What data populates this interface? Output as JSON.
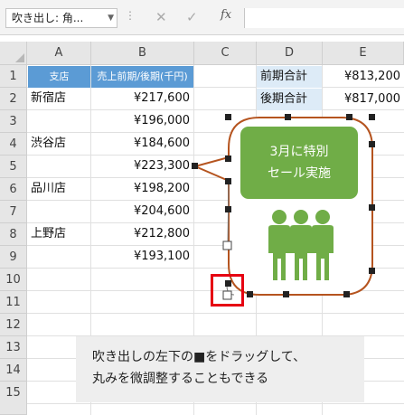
{
  "formula_bar": {
    "name_box": "吹き出し: 角...",
    "cancel_icon": "✕",
    "enter_icon": "✓",
    "fx_label": "fx",
    "formula": ""
  },
  "columns": [
    "A",
    "B",
    "C",
    "D",
    "E"
  ],
  "rows": [
    "1",
    "2",
    "3",
    "4",
    "5",
    "6",
    "7",
    "8",
    "9",
    "10",
    "11",
    "12",
    "13",
    "14",
    "15"
  ],
  "table": {
    "header_store": "支店",
    "header_sales": "売上前期/後期(千円)",
    "stores": [
      "新宿店",
      "",
      "渋谷店",
      "",
      "品川店",
      "",
      "上野店",
      ""
    ],
    "sales": [
      "¥217,600",
      "¥196,000",
      "¥184,600",
      "¥223,300",
      "¥198,200",
      "¥204,600",
      "¥212,800",
      "¥193,100"
    ]
  },
  "totals": {
    "first_label": "前期合計",
    "first_value": "¥813,200",
    "second_label": "後期合計",
    "second_value": "¥817,000"
  },
  "callout_shape": {
    "line1": "3月に特別",
    "line2": "セール実施",
    "icon": "people-group-icon",
    "border_color": "#b5541f",
    "box_color": "#70ad47"
  },
  "caption": {
    "line1": "吹き出しの左下の■をドラッグして、",
    "line2": "丸みを微調整することもできる"
  },
  "accent": {
    "header_blue": "#5b9bd5",
    "highlight_red": "#e60012"
  }
}
